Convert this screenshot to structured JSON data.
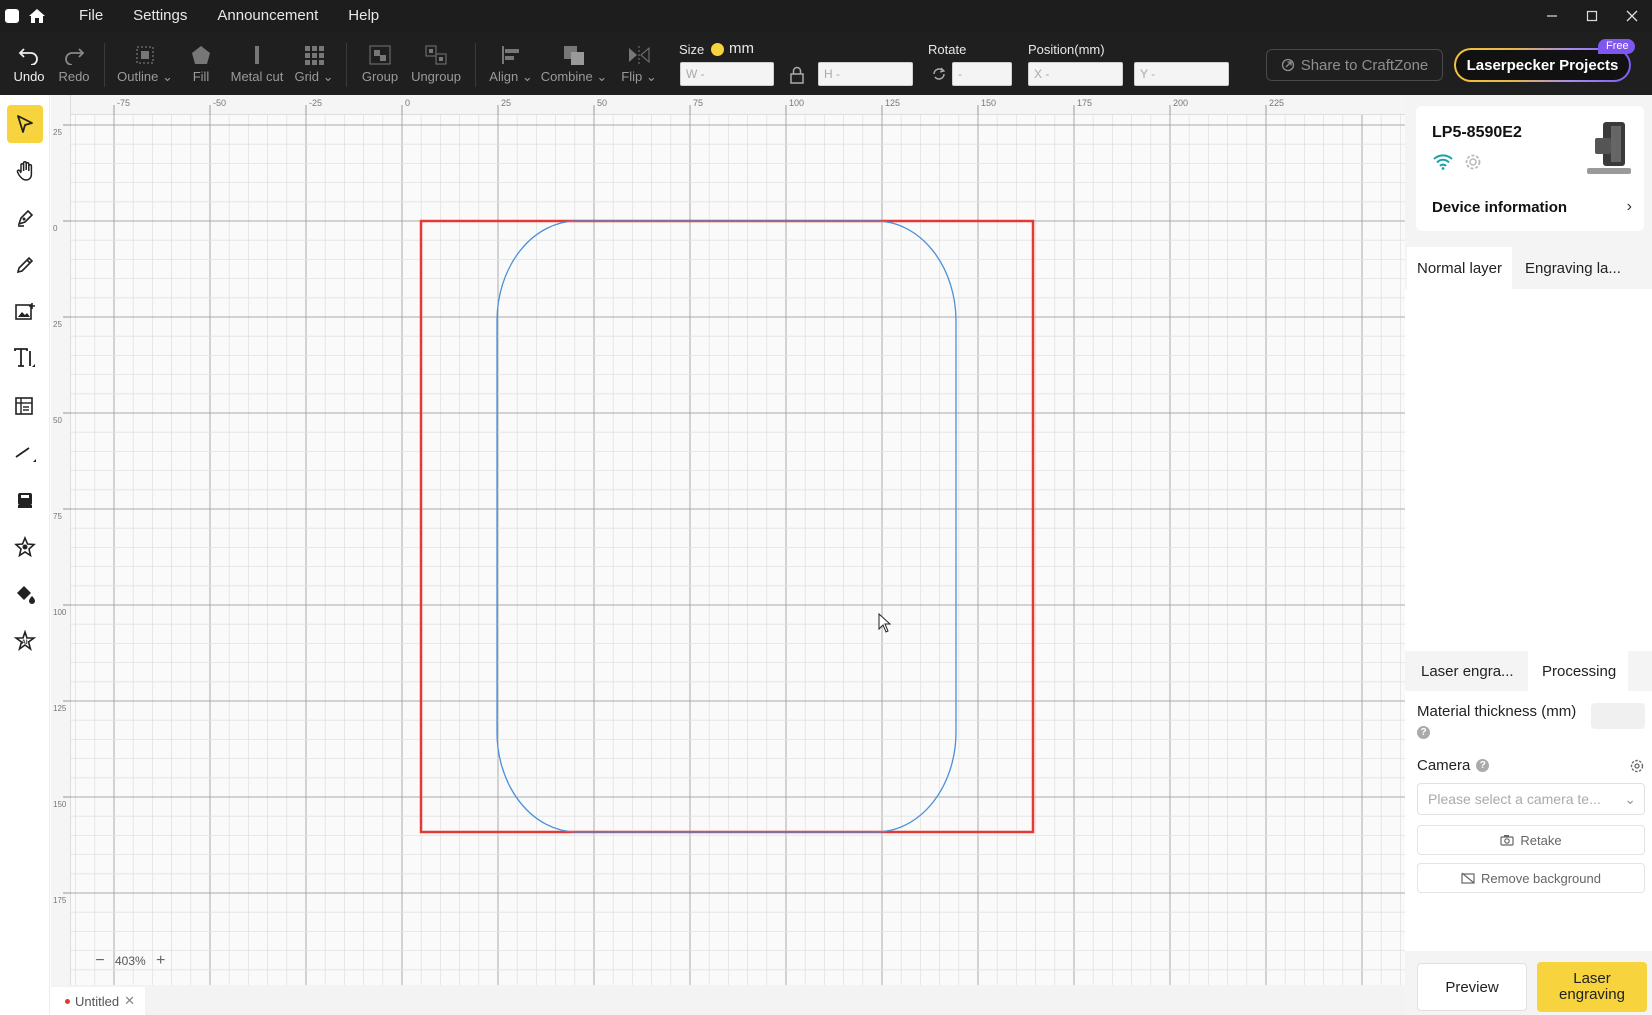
{
  "menu": {
    "items": [
      "File",
      "Settings",
      "Announcement",
      "Help"
    ]
  },
  "toolbar": {
    "undo": "Undo",
    "redo": "Redo",
    "outline": "Outline",
    "fill": "Fill",
    "metal_cut": "Metal cut",
    "grid": "Grid",
    "group": "Group",
    "ungroup": "Ungroup",
    "align": "Align",
    "combine": "Combine",
    "flip": "Flip",
    "size_label": "Size",
    "unit": "mm",
    "w_placeholder": "W -",
    "h_placeholder": "H -",
    "rotate_label": "Rotate",
    "rotate_placeholder": "-",
    "position_label": "Position(mm)",
    "x_placeholder": "X -",
    "y_placeholder": "Y -",
    "share": "Share to CraftZone",
    "projects": "Laserpecker Projects",
    "free_badge": "Free"
  },
  "tools": [
    "select-tool",
    "hand-tool",
    "pen-tool",
    "pencil-tool",
    "image-tool",
    "text-tool",
    "table-tool",
    "line-tool",
    "stamp-tool",
    "shape-tool",
    "fill-tool",
    "ai-tool"
  ],
  "canvas": {
    "ruler_top_labels": [
      "-75",
      "-50",
      "-25",
      "0",
      "25",
      "50",
      "75",
      "100",
      "125",
      "150",
      "175",
      "200",
      "225"
    ],
    "ruler_left_labels": [
      "25",
      "0",
      "25",
      "50",
      "75",
      "100",
      "125",
      "150",
      "175"
    ],
    "zoom": "403%",
    "selection_color": "#e53935",
    "shape_color": "#4a90d9"
  },
  "tabs": {
    "document": "Untitled"
  },
  "device": {
    "name": "LP5-8590E2",
    "info_label": "Device information"
  },
  "layers": {
    "normal": "Normal layer",
    "engraving": "Engraving la..."
  },
  "processing": {
    "tab_engrave": "Laser engra...",
    "tab_processing": "Processing",
    "material_thickness": "Material thickness (mm)",
    "camera": "Camera",
    "camera_placeholder": "Please select a camera te...",
    "retake": "Retake",
    "remove_background": "Remove background"
  },
  "actions": {
    "preview": "Preview",
    "laser_engraving": "Laser engraving"
  }
}
